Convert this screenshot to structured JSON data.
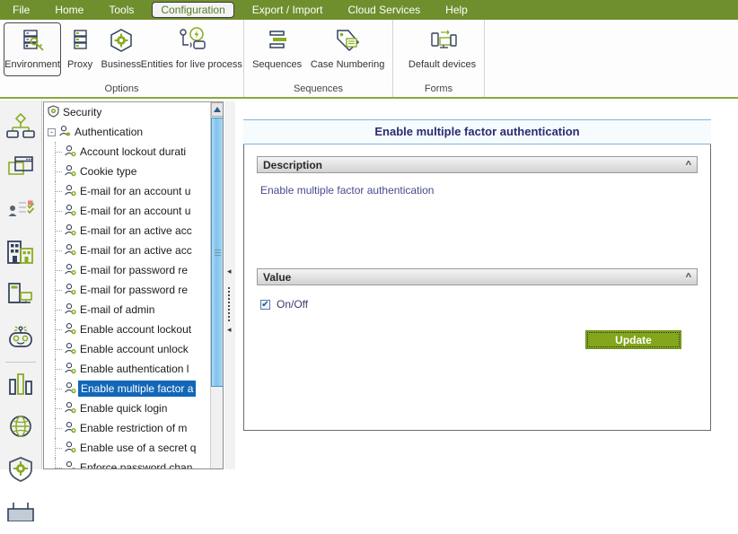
{
  "menubar": {
    "items": [
      {
        "label": "File",
        "active": false
      },
      {
        "label": "Home",
        "active": false
      },
      {
        "label": "Tools",
        "active": false
      },
      {
        "label": "Configuration",
        "active": true
      },
      {
        "label": "Export / Import",
        "active": false
      },
      {
        "label": "Cloud Services",
        "active": false
      },
      {
        "label": "Help",
        "active": false
      }
    ]
  },
  "ribbon": {
    "groups": [
      {
        "name": "Options",
        "buttons": [
          {
            "label": "Environment",
            "icon": "server-key-icon",
            "selected": true
          },
          {
            "label": "Proxy",
            "icon": "server-list-icon",
            "selected": false
          },
          {
            "label": "Business",
            "icon": "gear-hexagon-icon",
            "selected": false
          },
          {
            "label": "Entities for live process",
            "icon": "live-process-icon",
            "selected": false
          }
        ]
      },
      {
        "name": "Sequences",
        "buttons": [
          {
            "label": "Sequences",
            "icon": "sequence-bars-icon",
            "selected": false
          },
          {
            "label": "Case Numbering",
            "icon": "tag-list-icon",
            "selected": false
          }
        ]
      },
      {
        "name": "Forms",
        "buttons": [
          {
            "label": "Default devices",
            "icon": "devices-icon",
            "selected": false
          }
        ]
      }
    ]
  },
  "sidebar": {
    "items": [
      {
        "name": "workflow-icon"
      },
      {
        "name": "window-icon"
      },
      {
        "name": "user-tasks-icon"
      },
      {
        "name": "building-icon"
      },
      {
        "name": "devices-icon"
      },
      {
        "name": "robot-icon"
      },
      {
        "name": "separator"
      },
      {
        "name": "bar-chart-icon"
      },
      {
        "name": "globe-icon"
      },
      {
        "name": "shield-gear-icon"
      },
      {
        "name": "board-icon"
      }
    ]
  },
  "tree": {
    "root": {
      "label": "Security",
      "icon": "shield-icon"
    },
    "group": {
      "label": "Authentication",
      "icon": "user-key-icon",
      "expander": "-"
    },
    "items": [
      {
        "label": "Account lockout durati",
        "selected": false
      },
      {
        "label": "Cookie type",
        "selected": false
      },
      {
        "label": "E-mail for an account u",
        "selected": false
      },
      {
        "label": "E-mail for an account u",
        "selected": false
      },
      {
        "label": "E-mail for an active acc",
        "selected": false
      },
      {
        "label": "E-mail for an active acc",
        "selected": false
      },
      {
        "label": "E-mail for password re",
        "selected": false
      },
      {
        "label": "E-mail for password re",
        "selected": false
      },
      {
        "label": "E-mail of admin",
        "selected": false
      },
      {
        "label": "Enable account lockout",
        "selected": false
      },
      {
        "label": "Enable account unlock",
        "selected": false
      },
      {
        "label": "Enable authentication l",
        "selected": false
      },
      {
        "label": "Enable multiple factor a",
        "selected": true
      },
      {
        "label": "Enable quick login",
        "selected": false
      },
      {
        "label": "Enable restriction of m",
        "selected": false
      },
      {
        "label": "Enable use of a secret q",
        "selected": false
      },
      {
        "label": "Enforce password chan",
        "selected": false
      }
    ]
  },
  "content": {
    "title": "Enable multiple factor authentication",
    "description_section": {
      "header": "Description",
      "collapse_icon": "chevron-up-icon",
      "text": "Enable multiple factor authentication"
    },
    "value_section": {
      "header": "Value",
      "collapse_icon": "chevron-up-icon",
      "checkbox": {
        "label": "On/Off",
        "checked": true,
        "mark": "✔"
      },
      "update_button": "Update"
    }
  },
  "colors": {
    "brand_green": "#6f8f2e",
    "button_green": "#83a61c",
    "selection_blue": "#1267b8",
    "title_navy": "#2b2b72",
    "icon_navy": "#33415c",
    "icon_green": "#8aac22"
  }
}
